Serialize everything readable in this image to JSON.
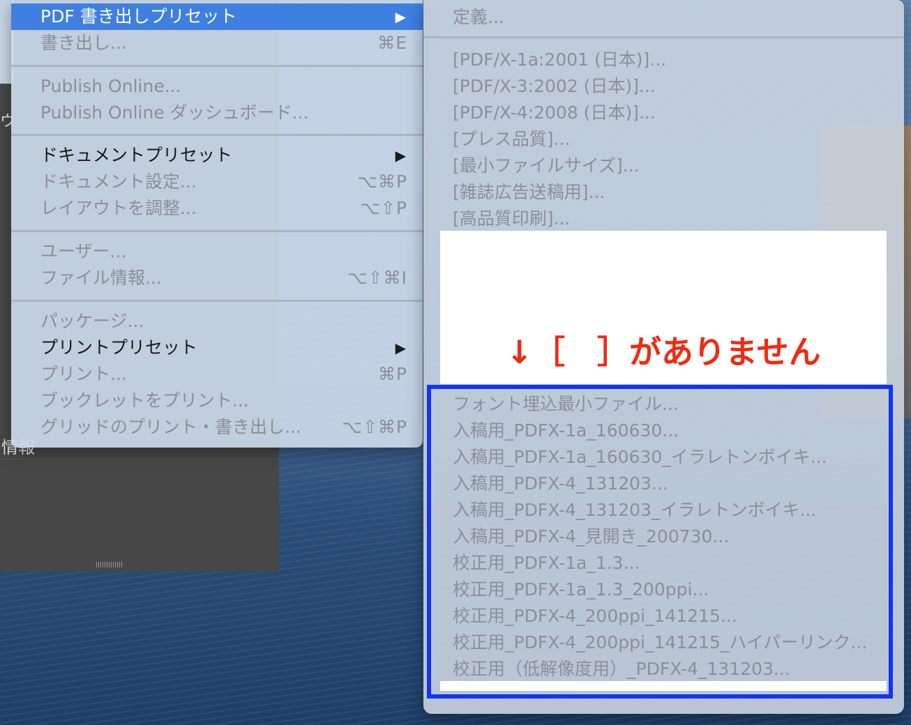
{
  "background": {
    "side_char": "ウ",
    "panel_label": "情報"
  },
  "main_menu": {
    "items": [
      {
        "label": "PDF 書き出しプリセット",
        "shortcut": "",
        "arrow": "▶"
      },
      {
        "label": "書き出し...",
        "shortcut": "⌘E"
      },
      {
        "label": "Publish Online...",
        "shortcut": ""
      },
      {
        "label": "Publish Online ダッシュボード...",
        "shortcut": ""
      },
      {
        "label": "ドキュメントプリセット",
        "shortcut": "",
        "arrow": "▶"
      },
      {
        "label": "ドキュメント設定...",
        "shortcut": "⌥⌘P"
      },
      {
        "label": "レイアウトを調整...",
        "shortcut": "⌥⇧P"
      },
      {
        "label": "ユーザー...",
        "shortcut": ""
      },
      {
        "label": "ファイル情報...",
        "shortcut": "⌥⇧⌘I"
      },
      {
        "label": "パッケージ...",
        "shortcut": ""
      },
      {
        "label": "プリントプリセット",
        "shortcut": "",
        "arrow": "▶"
      },
      {
        "label": "プリント...",
        "shortcut": "⌘P"
      },
      {
        "label": "ブックレットをプリント...",
        "shortcut": ""
      },
      {
        "label": "グリッドのプリント・書き出し...",
        "shortcut": "⌥⇧⌘P"
      }
    ]
  },
  "submenu": {
    "define": "定義...",
    "default_presets": [
      "[PDF/X-1a:2001 (日本)]...",
      "[PDF/X-3:2002 (日本)]...",
      "[PDF/X-4:2008 (日本)]...",
      "[プレス品質]...",
      "[最小ファイルサイズ]...",
      "[雑誌広告送稿用]...",
      "[高品質印刷]..."
    ],
    "custom_presets": [
      "フォント埋込最小ファイル...",
      "入稿用_PDFX-1a_160630...",
      "入稿用_PDFX-1a_160630_イラレトンボイキ...",
      "入稿用_PDFX-4_131203...",
      "入稿用_PDFX-4_131203_イラレトンボイキ...",
      "入稿用_PDFX-4_見開き_200730...",
      "校正用_PDFX-1a_1.3...",
      "校正用_PDFX-1a_1.3_200ppi...",
      "校正用_PDFX-4_200ppi_141215...",
      "校正用_PDFX-4_200ppi_141215_ハイパーリンク...",
      "校正用（低解像度用）_PDFX-4_131203..."
    ]
  },
  "annotation": {
    "text": "↓［　］がありません",
    "text_color": "#f02a10",
    "highlight_color": "#1234f5"
  }
}
